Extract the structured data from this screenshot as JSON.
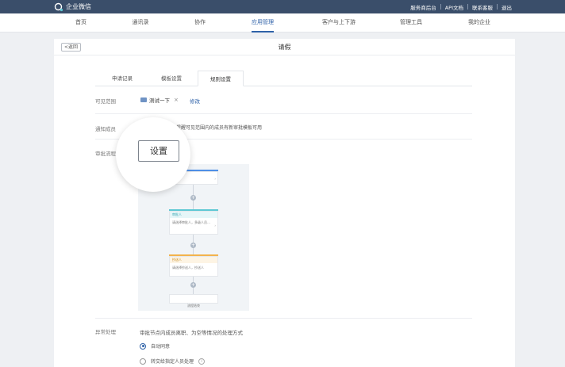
{
  "app": {
    "name": "企业微信"
  },
  "top_links": [
    "服务商后台",
    "API文档",
    "联系客服",
    "退出"
  ],
  "nav": {
    "items": [
      "首页",
      "通讯录",
      "协作",
      "应用管理",
      "客户与上下游",
      "管理工具",
      "我的企业"
    ],
    "active": "应用管理"
  },
  "page": {
    "back_label": "<返回",
    "title": "请假"
  },
  "tabs": {
    "items": [
      "申请记录",
      "模板设置",
      "规则设置"
    ],
    "active": "规则设置"
  },
  "rules": {
    "visible_range": {
      "label": "可见范围",
      "tag": "测试一下",
      "remove": "×",
      "modify": "修改"
    },
    "notify": {
      "label": "通知成员",
      "text": "向提醒可见范围内的成员有新审批模板可用"
    },
    "approval_flow": {
      "label": "审批流程",
      "set_button": "设置"
    },
    "exception": {
      "label": "异常处理",
      "description": "审批节点内成员离职、为空等情况的处理方式",
      "options": [
        {
          "label": "自动同意",
          "selected": true
        },
        {
          "label": "转交给指定人员处理",
          "selected": false
        }
      ],
      "info": "i"
    }
  },
  "flow_preview": {
    "approver_header": "审批人",
    "approver_text": "请选择审批人，多级人员…",
    "approver_text2": "审批人员(多人",
    "cc_header": "抄送人",
    "cc_text": "请选择抄送人，抄送人",
    "end_text": "流程结束"
  },
  "colors": {
    "topbar": "#3a4e6a",
    "accent": "#2f62a8",
    "approver": "#5ec8d4",
    "cc": "#f3b34c",
    "initiator": "#4f8fe6"
  }
}
